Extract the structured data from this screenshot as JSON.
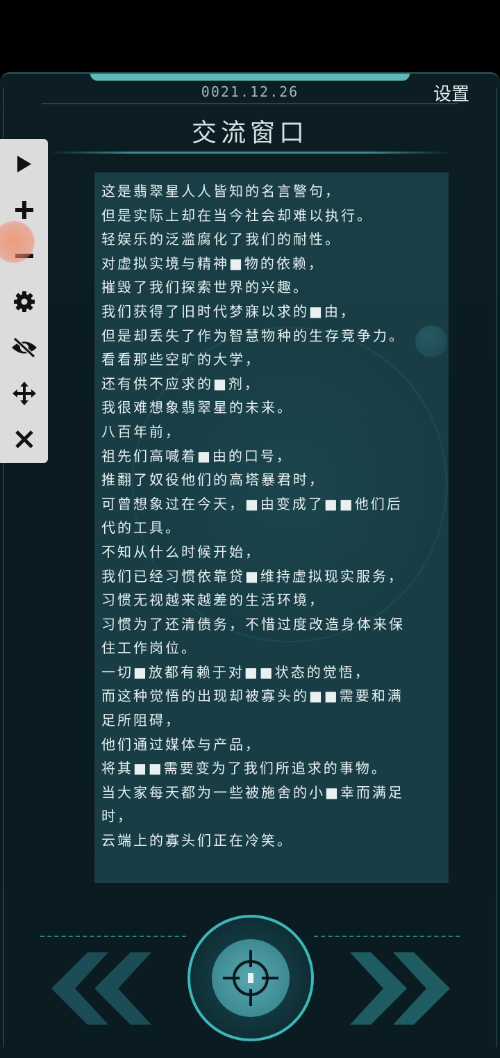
{
  "header": {
    "date": "0021.12.26",
    "settings_label": "设置",
    "title": "交流窗口"
  },
  "toolbar": {
    "items": [
      {
        "name": "play",
        "icon": "play-icon"
      },
      {
        "name": "zoom-in",
        "icon": "plus-icon"
      },
      {
        "name": "zoom-out",
        "icon": "minus-icon"
      },
      {
        "name": "settings",
        "icon": "gear-icon"
      },
      {
        "name": "hide",
        "icon": "eye-off-icon"
      },
      {
        "name": "move",
        "icon": "move-arrows-icon"
      },
      {
        "name": "close",
        "icon": "close-icon"
      }
    ]
  },
  "content": {
    "lines": [
      "这是翡翠星人人皆知的名言警句，",
      "但是实际上却在当今社会却难以执行。",
      "轻娱乐的泛滥腐化了我们的耐性。",
      "对虚拟实境与精神■物的依赖，",
      "摧毁了我们探索世界的兴趣。",
      "我们获得了旧时代梦寐以求的■由，",
      "但是却丢失了作为智慧物种的生存竞争力。",
      "看看那些空旷的大学，",
      "还有供不应求的■剂，",
      "我很难想象翡翠星的未来。",
      "八百年前，",
      "祖先们高喊着■由的口号，",
      "推翻了奴役他们的高塔暴君时，",
      "可曾想象过在今天，■由变成了■■他们后",
      "代的工具。",
      "不知从什么时候开始，",
      "我们已经习惯依靠贷■维持虚拟现实服务，",
      "习惯无视越来越差的生活环境，",
      "习惯为了还清债务，不惜过度改造身体来保",
      "住工作岗位。",
      "一切■放都有赖于对■■状态的觉悟，",
      "而这种觉悟的出现却被寡头的■■需要和满",
      "足所阻碍，",
      "他们通过媒体与产品，",
      "将其■■需要变为了我们所追求的事物。",
      "当大家每天都为一些被施舍的小■幸而满足",
      "时，",
      "云端上的寡头们正在冷笑。"
    ]
  },
  "nav": {
    "prev_icon": "double-chevron-left-icon",
    "next_icon": "double-chevron-right-icon",
    "center_icon": "crosshair-icon"
  },
  "colors": {
    "accent": "#3bb7b7",
    "panel": "#0c1d24",
    "text": "#e8f0f1",
    "text_box": "#2d6e78"
  }
}
